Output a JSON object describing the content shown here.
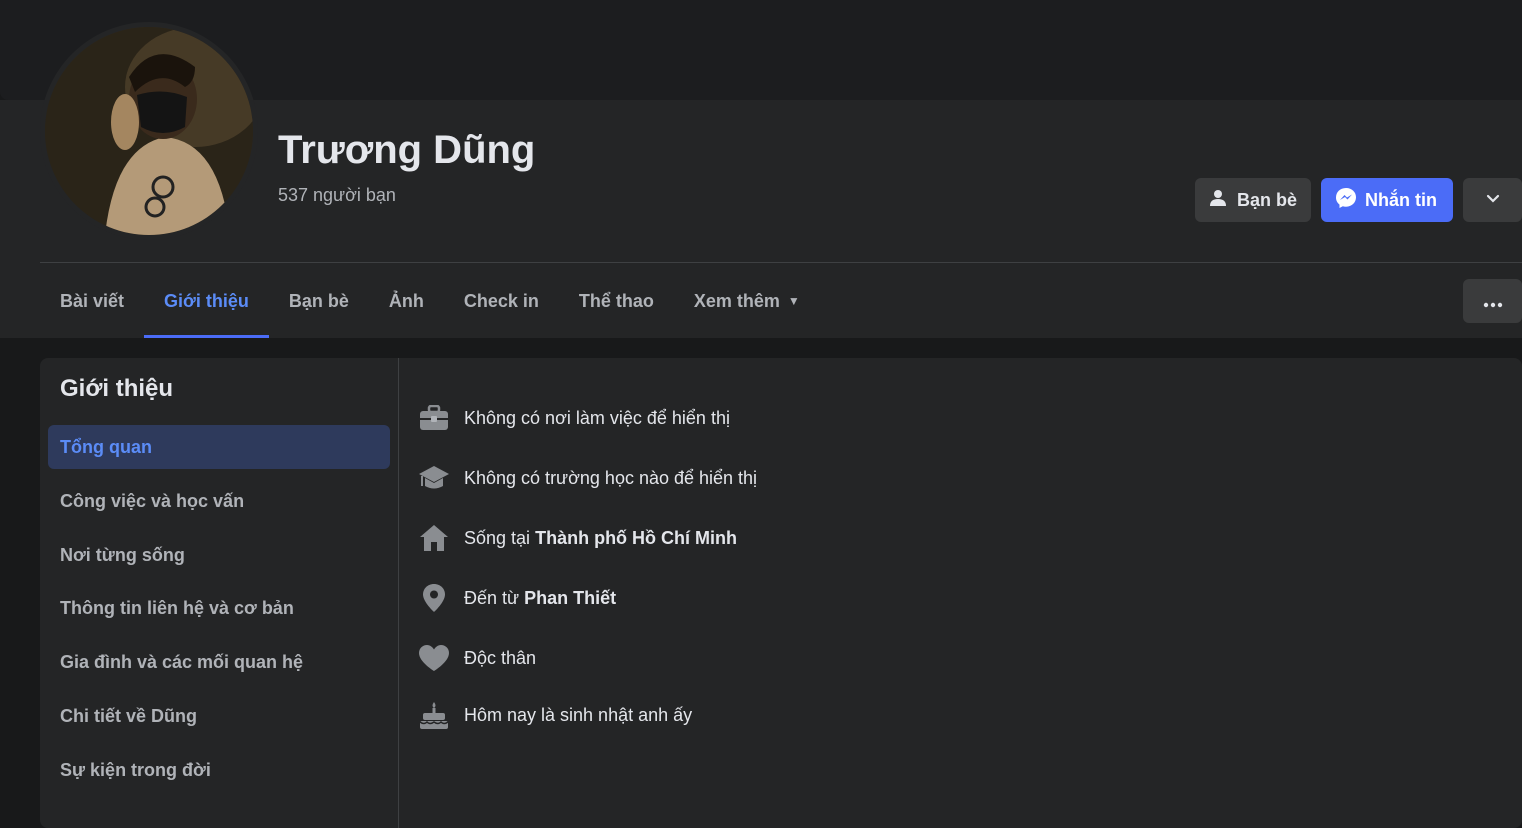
{
  "profile": {
    "name": "Trương Dũng",
    "friends_count": "537 người bạn"
  },
  "actions": {
    "friends_label": "Bạn bè",
    "message_label": "Nhắn tin"
  },
  "tabs": [
    {
      "label": "Bài viết"
    },
    {
      "label": "Giới thiệu"
    },
    {
      "label": "Bạn bè"
    },
    {
      "label": "Ảnh"
    },
    {
      "label": "Check in"
    },
    {
      "label": "Thể thao"
    },
    {
      "label": "Xem thêm"
    }
  ],
  "about": {
    "title": "Giới thiệu",
    "menu": [
      {
        "label": "Tổng quan"
      },
      {
        "label": "Công việc và học vấn"
      },
      {
        "label": "Nơi từng sống"
      },
      {
        "label": "Thông tin liên hệ và cơ bản"
      },
      {
        "label": "Gia đình và các mối quan hệ"
      },
      {
        "label": "Chi tiết về Dũng"
      },
      {
        "label": "Sự kiện trong đời"
      }
    ],
    "items": [
      {
        "icon": "briefcase-icon",
        "text": "Không có nơi làm việc để hiển thị"
      },
      {
        "icon": "graduation-cap-icon",
        "text": "Không có trường học nào để hiển thị"
      },
      {
        "icon": "home-icon",
        "prefix": "Sống tại",
        "value": "Thành phố Hồ Chí Minh"
      },
      {
        "icon": "location-pin-icon",
        "prefix": "Đến từ",
        "value": "Phan Thiết"
      },
      {
        "icon": "heart-icon",
        "text": "Độc thân"
      },
      {
        "icon": "birthday-cake-icon",
        "text": "Hôm nay là sinh nhật anh ấy"
      }
    ]
  },
  "colors": {
    "background": "#18191a",
    "panel": "#242526",
    "accent": "#4b6cf7",
    "text_secondary": "#b0b3b8"
  }
}
